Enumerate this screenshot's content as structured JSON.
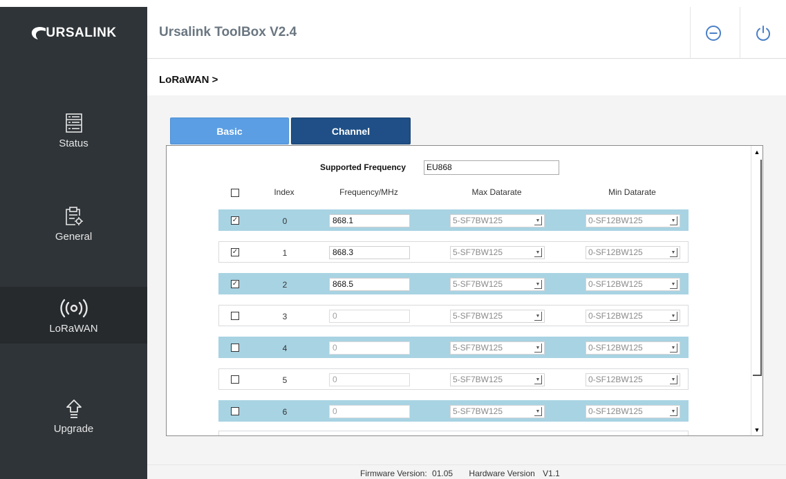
{
  "brand": {
    "logo_text": "URSALINK"
  },
  "header": {
    "title": "Ursalink ToolBox V2.4",
    "minimize_icon": "minus-circle-icon",
    "power_icon": "power-icon"
  },
  "sidebar": {
    "items": [
      {
        "label": "Status",
        "icon": "status-list-icon"
      },
      {
        "label": "General",
        "icon": "clipboard-gear-icon"
      },
      {
        "label": "LoRaWAN",
        "icon": "radio-wave-icon"
      },
      {
        "label": "Upgrade",
        "icon": "upload-arrow-icon"
      }
    ],
    "active": "LoRaWAN"
  },
  "breadcrumb": "LoRaWAN >",
  "tabs": [
    {
      "label": "Basic"
    },
    {
      "label": "Channel"
    }
  ],
  "active_tab": "Channel",
  "supported_frequency": {
    "label": "Supported Frequency",
    "value": "EU868"
  },
  "columns": {
    "index": "Index",
    "frequency": "Frequency/MHz",
    "max_datarate": "Max Datarate",
    "min_datarate": "Min Datarate"
  },
  "rows": [
    {
      "checked": true,
      "index": "0",
      "frequency": "868.1",
      "max": "5-SF7BW125",
      "min": "0-SF12BW125"
    },
    {
      "checked": true,
      "index": "1",
      "frequency": "868.3",
      "max": "5-SF7BW125",
      "min": "0-SF12BW125"
    },
    {
      "checked": true,
      "index": "2",
      "frequency": "868.5",
      "max": "5-SF7BW125",
      "min": "0-SF12BW125"
    },
    {
      "checked": false,
      "index": "3",
      "frequency": "0",
      "max": "5-SF7BW125",
      "min": "0-SF12BW125"
    },
    {
      "checked": false,
      "index": "4",
      "frequency": "0",
      "max": "5-SF7BW125",
      "min": "0-SF12BW125"
    },
    {
      "checked": false,
      "index": "5",
      "frequency": "0",
      "max": "5-SF7BW125",
      "min": "0-SF12BW125"
    },
    {
      "checked": false,
      "index": "6",
      "frequency": "0",
      "max": "5-SF7BW125",
      "min": "0-SF12BW125"
    }
  ],
  "footer": {
    "firmware_label": "Firmware Version:",
    "firmware_value": "01.05",
    "hardware_label": "Hardware Version",
    "hardware_value": "V1.1"
  },
  "colors": {
    "sidebar": "#2f3438",
    "tab_basic": "#5b9ee3",
    "tab_channel": "#1f4f86",
    "row_alt": "#a8d3e3",
    "icon_accent": "#4a7fc7"
  }
}
